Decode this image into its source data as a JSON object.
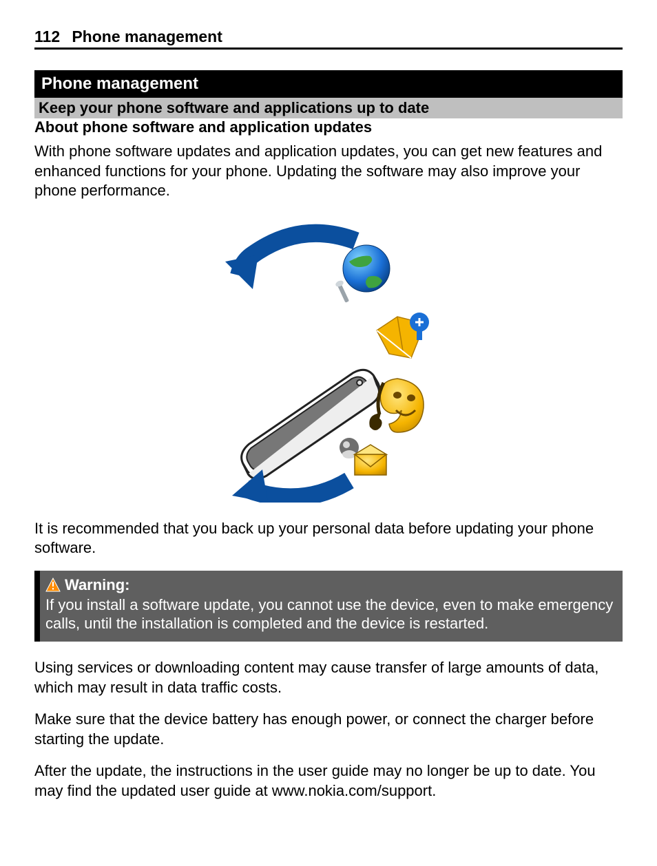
{
  "header": {
    "page_number": "112",
    "section_name": "Phone management"
  },
  "section_title": "Phone management",
  "sub_title": "Keep your phone software and applications up to date",
  "sub_sub_title": "About phone software and application updates",
  "para1": "With phone software updates and application updates, you can get new features and enhanced functions for your phone. Updating the software may also improve your phone performance.",
  "para2": "It is recommended that you back up your personal data before updating your phone software.",
  "warning": {
    "label": "Warning:",
    "text": "If you install a software update, you cannot use the device, even to make emergency calls, until the installation is completed and the device is restarted."
  },
  "para3": "Using services or downloading content may cause transfer of large amounts of data, which may result in data traffic costs.",
  "para4": "Make sure that the device battery has enough power, or connect the charger before starting the update.",
  "para5": "After the update, the instructions in the user guide may no longer be up to date. You may find the updated user guide at www.nokia.com/support."
}
